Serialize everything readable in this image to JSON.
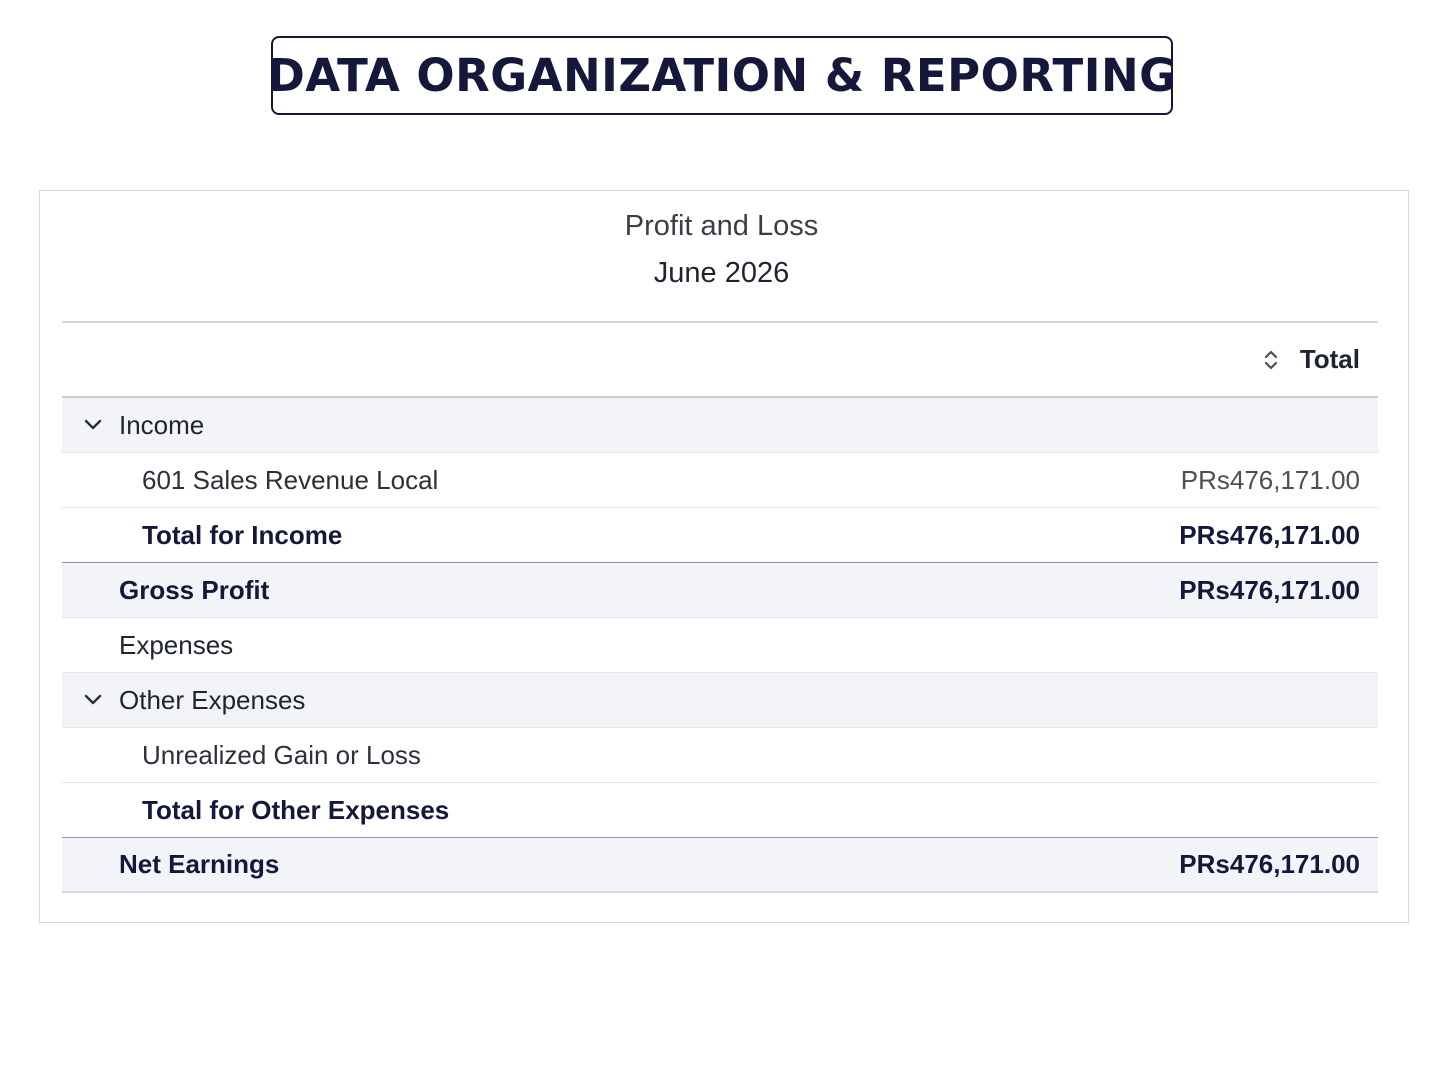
{
  "banner": {
    "title": "DATA ORGANIZATION & REPORTING"
  },
  "report": {
    "title": "Profit and Loss",
    "period": "June 2026",
    "column_header": "Total",
    "rows": [
      {
        "label": "Income",
        "amount": "",
        "level": 1,
        "expandable": true,
        "expanded": true,
        "bold": false,
        "shaded": true
      },
      {
        "label": "601 Sales Revenue Local",
        "amount": "PRs476,171.00",
        "level": 2,
        "expandable": false,
        "bold": false,
        "shaded": false
      },
      {
        "label": "Total for Income",
        "amount": "PRs476,171.00",
        "level": 2,
        "expandable": false,
        "bold": true,
        "shaded": false
      },
      {
        "label": "Gross Profit",
        "amount": "PRs476,171.00",
        "level": 1,
        "expandable": false,
        "bold": true,
        "shaded": true
      },
      {
        "label": "Expenses",
        "amount": "",
        "level": 1,
        "expandable": false,
        "bold": false,
        "shaded": false
      },
      {
        "label": "Other Expenses",
        "amount": "",
        "level": 1,
        "expandable": true,
        "expanded": true,
        "bold": false,
        "shaded": true
      },
      {
        "label": "Unrealized Gain or Loss",
        "amount": "",
        "level": 2,
        "expandable": false,
        "bold": false,
        "shaded": false
      },
      {
        "label": "Total for Other Expenses",
        "amount": "",
        "level": 2,
        "expandable": false,
        "bold": true,
        "shaded": false
      },
      {
        "label": "Net Earnings",
        "amount": "PRs476,171.00",
        "level": 1,
        "expandable": false,
        "bold": true,
        "shaded": true
      }
    ]
  },
  "icons": {
    "sort": "sort-updown-icon",
    "expand": "chevron-down-icon"
  }
}
